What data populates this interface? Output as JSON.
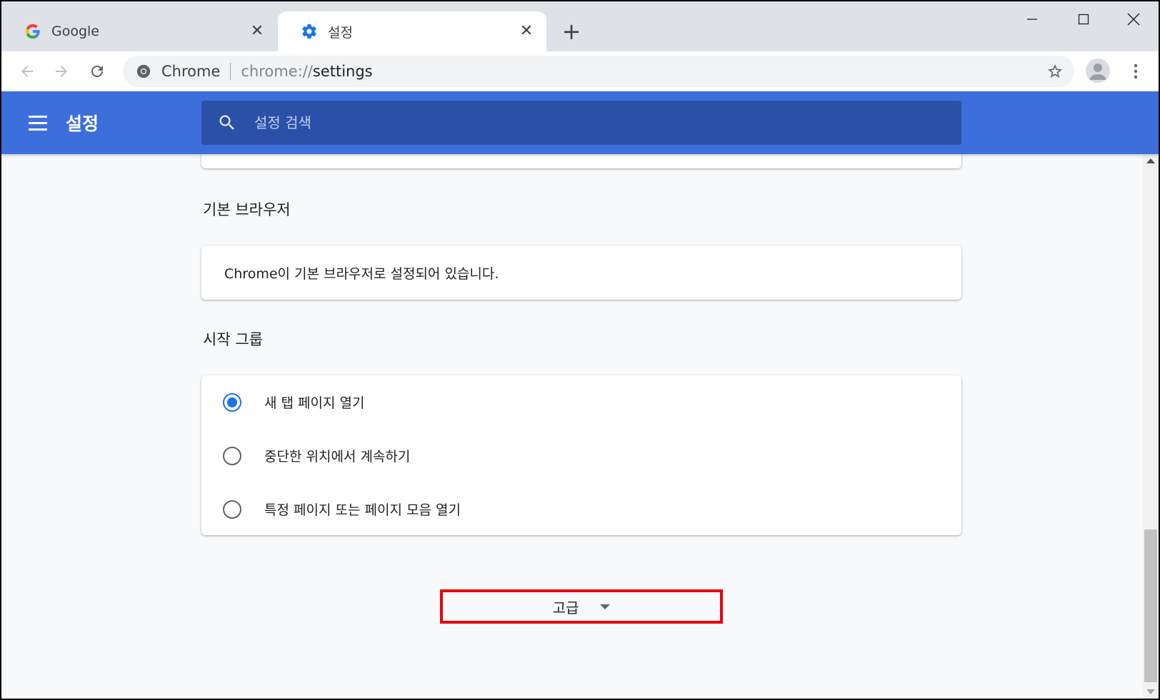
{
  "tabs": [
    {
      "title": "Google",
      "icon": "google-logo-icon"
    },
    {
      "title": "설정",
      "icon": "gear-icon",
      "active": true
    }
  ],
  "address_bar": {
    "chip": "Chrome",
    "scheme": "chrome://",
    "host": "settings"
  },
  "settings_header": {
    "title": "설정",
    "search_placeholder": "설정 검색"
  },
  "sections": {
    "default_browser": {
      "title": "기본 브라우저",
      "text": "Chrome이 기본 브라우저로 설정되어 있습니다."
    },
    "startup": {
      "title": "시작 그룹",
      "options": [
        {
          "label": "새 탭 페이지 열기",
          "checked": true
        },
        {
          "label": "중단한 위치에서 계속하기",
          "checked": false
        },
        {
          "label": "특정 페이지 또는 페이지 모음 열기",
          "checked": false
        }
      ]
    }
  },
  "advanced": {
    "label": "고급"
  },
  "colors": {
    "header_bg": "#3c6fdb",
    "search_bg": "#2b50a8",
    "accent": "#1a73e8",
    "highlight_border": "#e8000b"
  }
}
